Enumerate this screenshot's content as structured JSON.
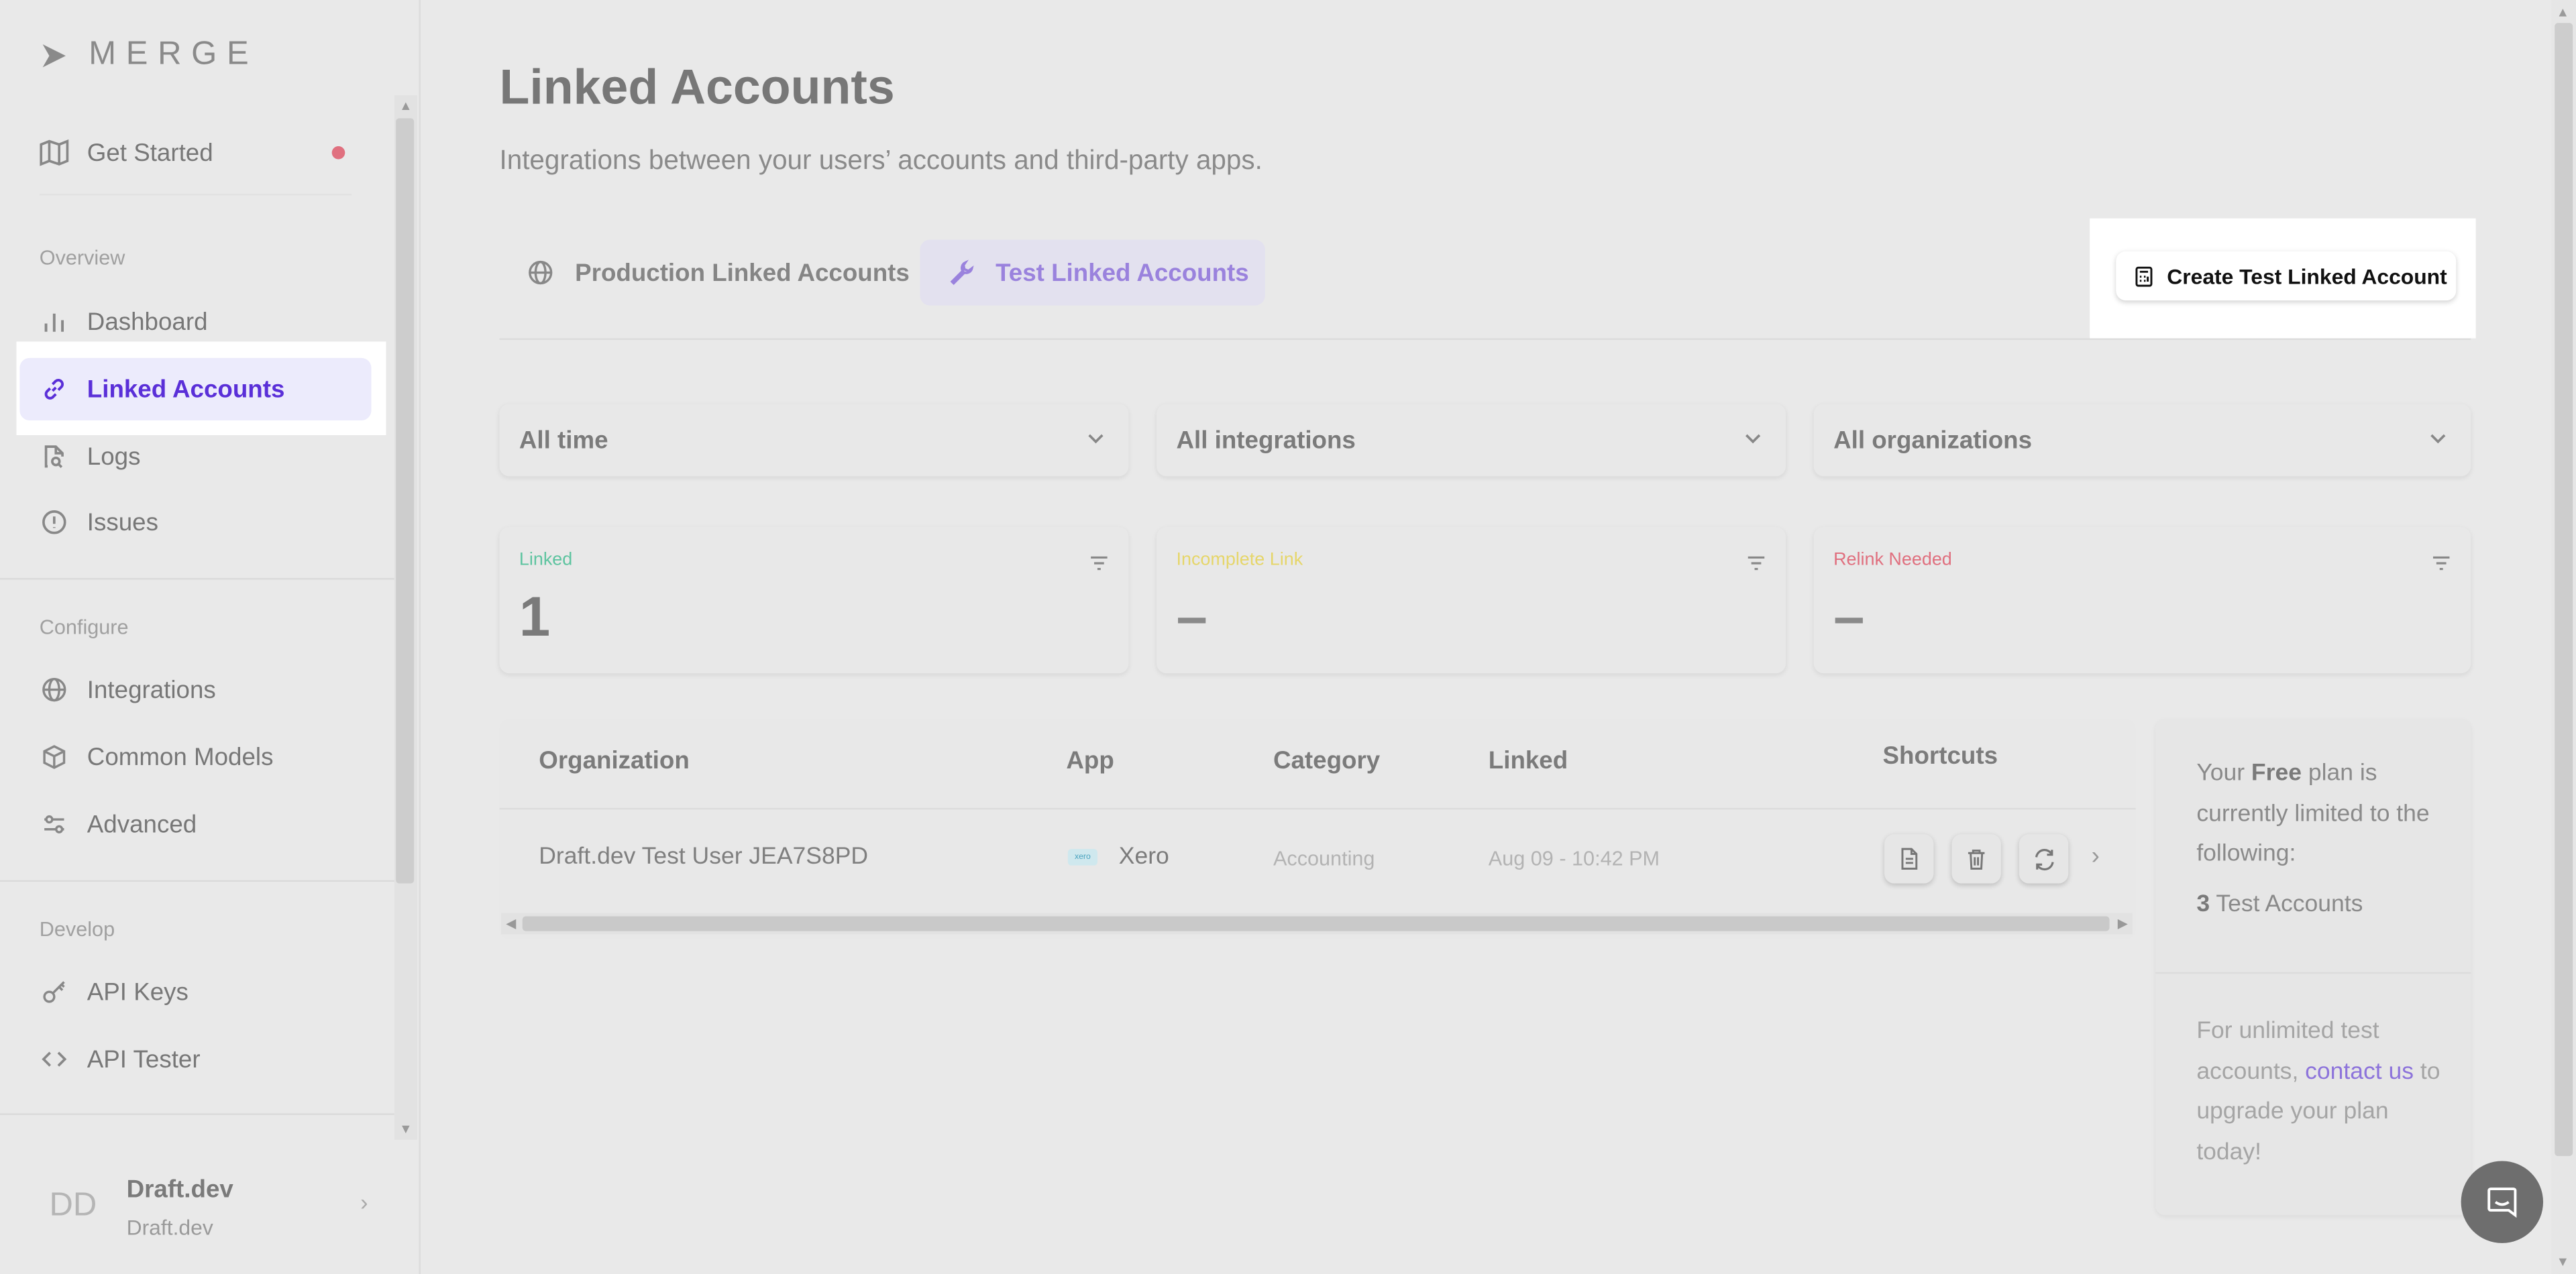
{
  "brand": {
    "name": "MERGE"
  },
  "sidebar": {
    "get_started": "Get Started",
    "sections": {
      "overview": "Overview",
      "configure": "Configure",
      "develop": "Develop"
    },
    "items": {
      "dashboard": "Dashboard",
      "linked_accounts": "Linked Accounts",
      "logs": "Logs",
      "issues": "Issues",
      "integrations": "Integrations",
      "common_models": "Common Models",
      "advanced": "Advanced",
      "api_keys": "API Keys",
      "api_tester": "API Tester"
    },
    "user": {
      "initials": "DD",
      "name": "Draft.dev",
      "org": "Draft.dev"
    }
  },
  "page": {
    "title": "Linked Accounts",
    "subtitle": "Integrations between your users’ accounts and third-party apps."
  },
  "tabs": {
    "production": "Production Linked Accounts",
    "test": "Test Linked Accounts"
  },
  "create_button": "Create Test Linked Account",
  "filters": {
    "time": "All time",
    "integrations": "All integrations",
    "organizations": "All organizations"
  },
  "stats": {
    "linked": {
      "label": "Linked",
      "value": "1"
    },
    "incomplete": {
      "label": "Incomplete Link",
      "value": "–"
    },
    "relink": {
      "label": "Relink Needed",
      "value": "–"
    }
  },
  "table": {
    "headers": {
      "organization": "Organization",
      "app": "App",
      "category": "Category",
      "linked": "Linked",
      "shortcuts": "Shortcuts"
    },
    "row": {
      "organization": "Draft.dev Test User JEA7S8PD",
      "app_logo": "xero",
      "app": "Xero",
      "category": "Accounting",
      "linked": "Aug 09 - 10:42 PM"
    }
  },
  "plan": {
    "line_pre": "Your ",
    "plan_name": "Free",
    "line_post": " plan is currently limited to the following:",
    "count": "3",
    "count_label": " Test Accounts",
    "unlimited_pre": "For unlimited test accounts, ",
    "contact_link": "contact us",
    "unlimited_post": " to upgrade your plan today!"
  },
  "colors": {
    "accent": "#5a2fd8",
    "linked": "#5ec4a0",
    "incomplete": "#e6d66a",
    "relink": "#e0707f"
  }
}
